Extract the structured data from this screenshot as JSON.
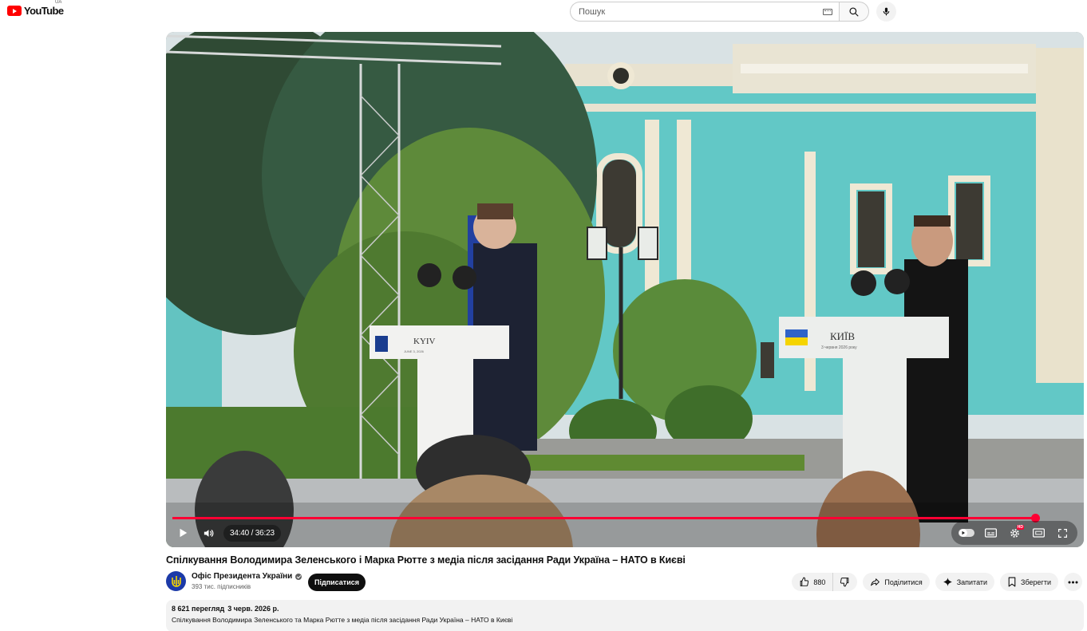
{
  "header": {
    "logo_text": "YouTube",
    "country_code": "UA",
    "search_placeholder": "Пошук"
  },
  "player": {
    "current_time": "34:40",
    "duration": "36:23",
    "time_separator": " / ",
    "progress_fraction": 0.953,
    "podium_left": {
      "city": "KYIV",
      "date": "JUNE 3, 2026"
    },
    "podium_right": {
      "city": "КИЇВ",
      "date": "3 червня 2026 року"
    }
  },
  "video": {
    "title": "Спілкування Володимира Зеленського і Марка Рютте з медіа після засідання Ради Україна – НАТО в Києві",
    "channel_name": "Офіс Президента України",
    "subscribers": "393 тис. підписників",
    "subscribe_label": "Підписатися",
    "like_count": "880",
    "share_label": "Поділитися",
    "ask_label": "Запитати",
    "save_label": "Зберегти"
  },
  "description": {
    "views": "8 621 перегляд",
    "date": "3 черв. 2026 р.",
    "text": "Спілкування Володимира Зеленського та Марка Рютте з медіа після засідання Ради Україна – НАТО в Києві"
  },
  "colors": {
    "brand_red": "#ff0000",
    "progress": "#ff0033",
    "palace_teal": "#62c8c6"
  }
}
